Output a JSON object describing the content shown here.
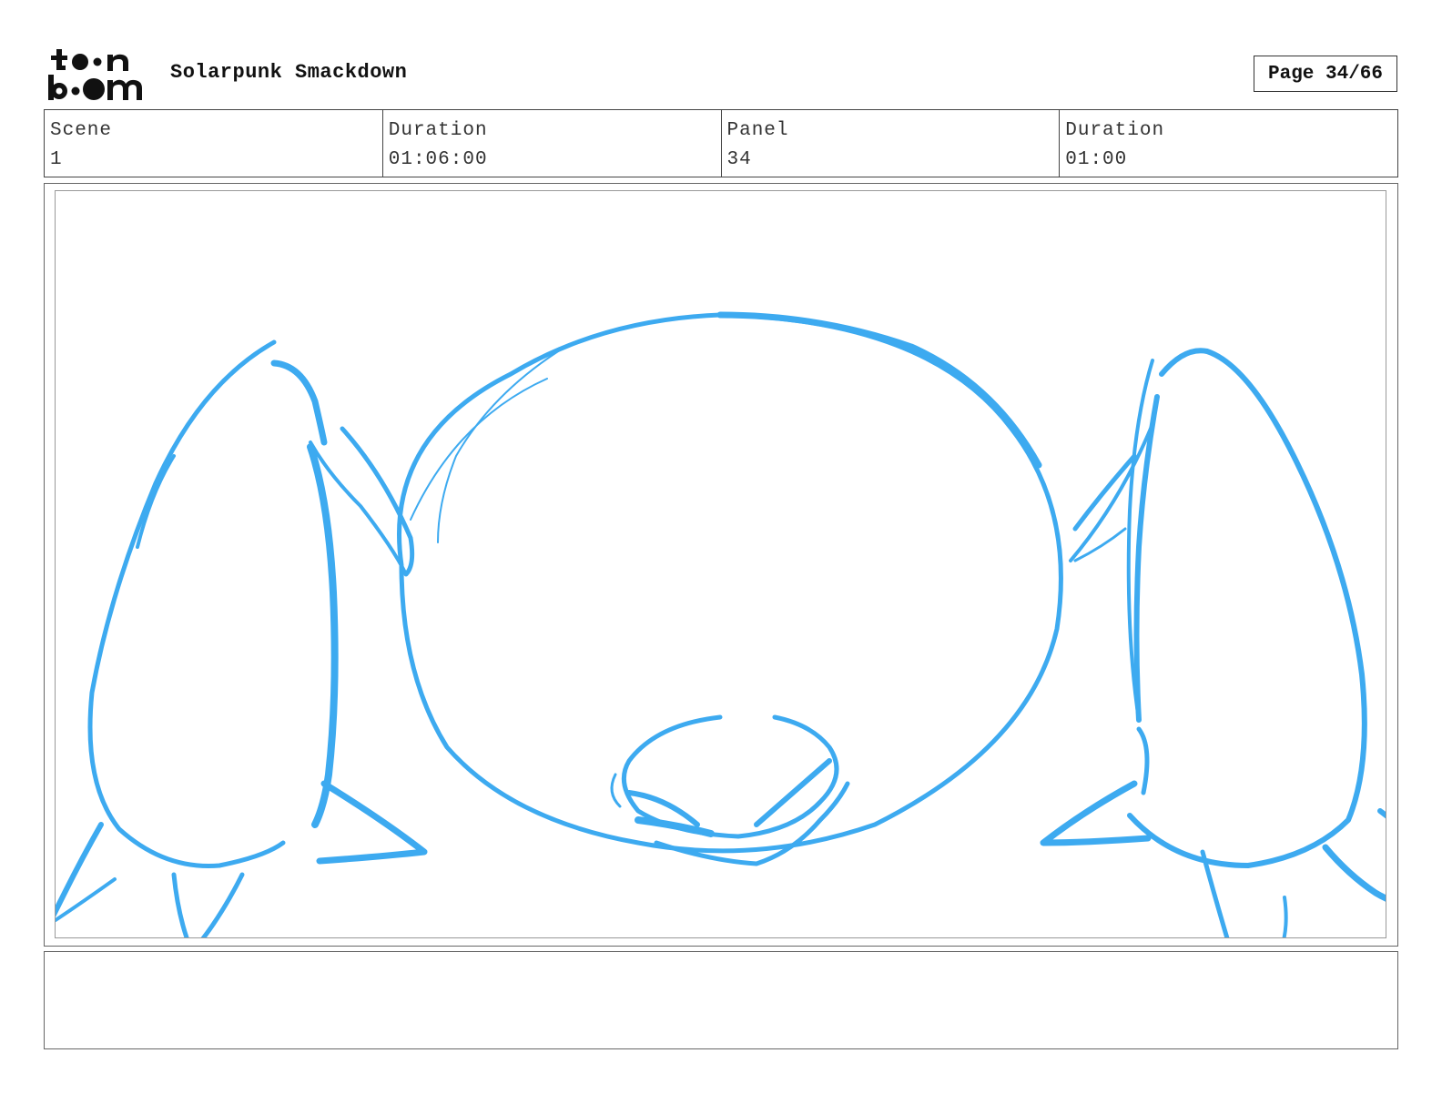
{
  "header": {
    "logo_text_top": "toon",
    "logo_text_bottom": "boom",
    "project_title": "Solarpunk Smackdown",
    "page_label": "Page 34/66"
  },
  "info": {
    "scene_label": "Scene",
    "scene_value": "1",
    "scene_duration_label": "Duration",
    "scene_duration_value": "01:06:00",
    "panel_label": "Panel",
    "panel_value": "34",
    "panel_duration_label": "Duration",
    "panel_duration_value": "01:00"
  },
  "sketch": {
    "stroke_color": "#3daaf0"
  },
  "notes": {
    "text": ""
  }
}
